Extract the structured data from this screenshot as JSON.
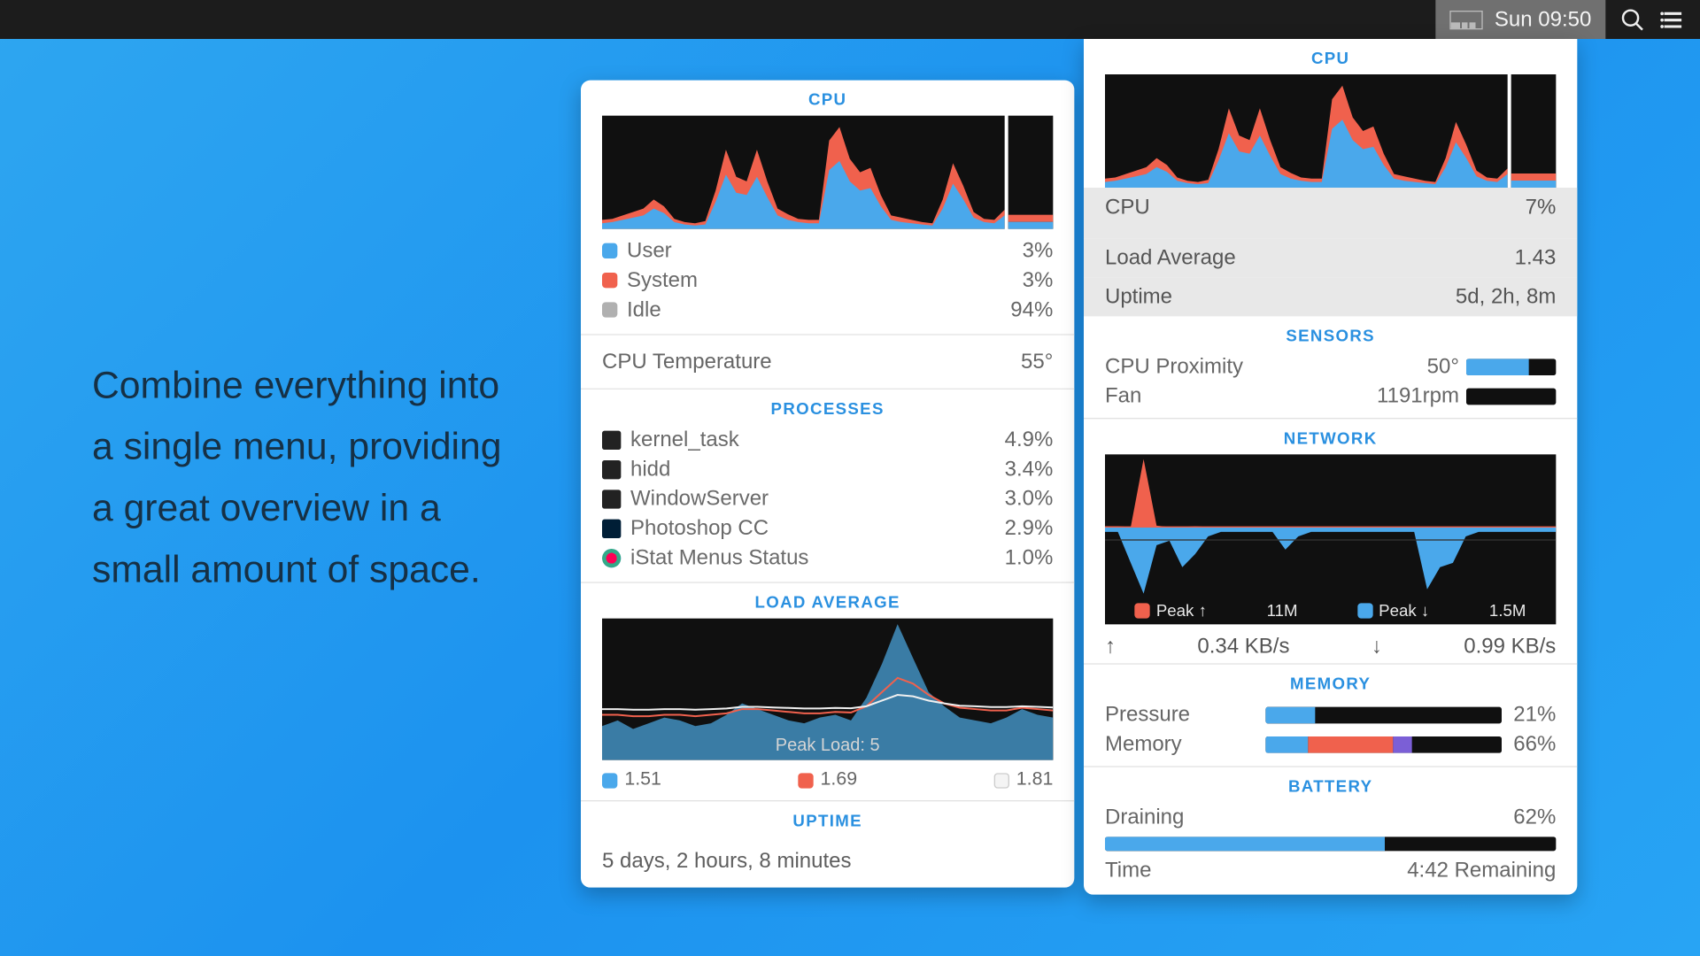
{
  "menubar": {
    "clock": "Sun 09:50"
  },
  "marketing": "Combine everything into a single menu, providing a great overview in a small amount of space.",
  "left_panel": {
    "cpu": {
      "title": "CPU",
      "legend": [
        {
          "label": "User",
          "value": "3%",
          "color": "blue"
        },
        {
          "label": "System",
          "value": "3%",
          "color": "red"
        },
        {
          "label": "Idle",
          "value": "94%",
          "color": "grey"
        }
      ],
      "temp_label": "CPU Temperature",
      "temp_value": "55°"
    },
    "processes": {
      "title": "PROCESSES",
      "items": [
        {
          "name": "kernel_task",
          "value": "4.9%",
          "icon": "term"
        },
        {
          "name": "hidd",
          "value": "3.4%",
          "icon": "term"
        },
        {
          "name": "WindowServer",
          "value": "3.0%",
          "icon": "term"
        },
        {
          "name": "Photoshop CC",
          "value": "2.9%",
          "icon": "ps"
        },
        {
          "name": "iStat Menus Status",
          "value": "1.0%",
          "icon": "istat"
        }
      ]
    },
    "load": {
      "title": "LOAD AVERAGE",
      "peak_label": "Peak Load: 5",
      "values": [
        "1.51",
        "1.69",
        "1.81"
      ]
    },
    "uptime": {
      "title": "UPTIME",
      "value": "5 days, 2 hours, 8 minutes"
    }
  },
  "right_panel": {
    "cpu": {
      "title": "CPU",
      "cpu_label": "CPU",
      "cpu_value": "7%",
      "load_label": "Load Average",
      "load_value": "1.43",
      "uptime_label": "Uptime",
      "uptime_value": "5d, 2h, 8m"
    },
    "sensors": {
      "title": "SENSORS",
      "rows": [
        {
          "label": "CPU Proximity",
          "value": "50°",
          "bar": 70
        },
        {
          "label": "Fan",
          "value": "1191rpm",
          "bar": 0
        }
      ]
    },
    "network": {
      "title": "NETWORK",
      "peak_up_label": "Peak ↑",
      "peak_up_value": "11M",
      "peak_down_label": "Peak ↓",
      "peak_down_value": "1.5M",
      "up_label": "↑",
      "up_value": "0.34 KB/s",
      "down_label": "↓",
      "down_value": "0.99 KB/s"
    },
    "memory": {
      "title": "MEMORY",
      "rows": [
        {
          "label": "Pressure",
          "value": "21%",
          "segments": [
            {
              "w": 21,
              "c": "#4aa8eb"
            }
          ]
        },
        {
          "label": "Memory",
          "value": "66%",
          "segments": [
            {
              "w": 18,
              "c": "#4aa8eb"
            },
            {
              "w": 36,
              "c": "#f0614d"
            },
            {
              "w": 8,
              "c": "#7b5fd6"
            }
          ]
        }
      ]
    },
    "battery": {
      "title": "BATTERY",
      "state_label": "Draining",
      "state_value": "62%",
      "time_label": "Time",
      "time_value": "4:42 Remaining",
      "bar": 62
    }
  },
  "chart_data": [
    {
      "name": "cpu_left_panel",
      "type": "area",
      "x": [
        0,
        1,
        2,
        3,
        4,
        5,
        6,
        7,
        8,
        9,
        10,
        11,
        12,
        13,
        14,
        15,
        16,
        17,
        18,
        19,
        20,
        21,
        22,
        23,
        24,
        25,
        26,
        27,
        28,
        29,
        30,
        31,
        32,
        33,
        34,
        35,
        36,
        37,
        38,
        39
      ],
      "series": [
        {
          "name": "User",
          "color": "#4aa8eb",
          "values": [
            5,
            6,
            8,
            10,
            12,
            18,
            14,
            6,
            4,
            3,
            4,
            24,
            48,
            32,
            30,
            46,
            28,
            12,
            8,
            6,
            5,
            5,
            52,
            60,
            42,
            34,
            36,
            20,
            8,
            6,
            5,
            4,
            3,
            18,
            40,
            26,
            10,
            6,
            5,
            12
          ]
        },
        {
          "name": "System",
          "color": "#f0614d",
          "values": [
            3,
            3,
            4,
            5,
            6,
            8,
            6,
            3,
            2,
            2,
            3,
            10,
            22,
            14,
            12,
            24,
            14,
            6,
            5,
            3,
            3,
            3,
            26,
            30,
            20,
            16,
            18,
            10,
            4,
            4,
            3,
            2,
            2,
            8,
            18,
            12,
            5,
            3,
            3,
            5
          ]
        }
      ],
      "ylim": [
        0,
        100
      ],
      "xlabel": "",
      "ylabel": "",
      "title": "CPU"
    },
    {
      "name": "load_average_left_panel",
      "type": "area",
      "x": [
        0,
        1,
        2,
        3,
        4,
        5,
        6,
        7,
        8,
        9,
        10,
        11,
        12,
        13,
        14,
        15,
        16,
        17,
        18,
        19,
        20,
        21,
        22,
        23,
        24,
        25,
        26,
        27,
        28,
        29
      ],
      "series": [
        {
          "name": "1m",
          "color": "#3a7ca5",
          "values": [
            1.2,
            1.4,
            1.1,
            1.3,
            1.5,
            1.4,
            1.2,
            1.3,
            1.6,
            2.0,
            1.8,
            1.6,
            1.4,
            1.3,
            1.5,
            1.6,
            1.4,
            2.2,
            3.4,
            4.8,
            3.6,
            2.4,
            1.9,
            1.5,
            1.4,
            1.3,
            1.5,
            1.8,
            1.6,
            1.5
          ]
        },
        {
          "name": "5m",
          "color": "#f0614d",
          "values": [
            1.6,
            1.6,
            1.55,
            1.55,
            1.6,
            1.6,
            1.55,
            1.6,
            1.65,
            1.8,
            1.8,
            1.75,
            1.7,
            1.65,
            1.65,
            1.7,
            1.68,
            1.9,
            2.4,
            2.9,
            2.7,
            2.3,
            2.0,
            1.85,
            1.8,
            1.75,
            1.75,
            1.85,
            1.8,
            1.75
          ]
        },
        {
          "name": "15m",
          "color": "#f0f0f0",
          "values": [
            1.8,
            1.8,
            1.78,
            1.78,
            1.8,
            1.8,
            1.78,
            1.8,
            1.82,
            1.88,
            1.88,
            1.86,
            1.84,
            1.82,
            1.82,
            1.84,
            1.83,
            1.9,
            2.1,
            2.3,
            2.25,
            2.1,
            2.0,
            1.92,
            1.9,
            1.87,
            1.87,
            1.9,
            1.88,
            1.86
          ]
        }
      ],
      "ylim": [
        0,
        5
      ],
      "peak": 5,
      "title": "LOAD AVERAGE"
    },
    {
      "name": "cpu_right_panel",
      "type": "area",
      "x": [
        0,
        1,
        2,
        3,
        4,
        5,
        6,
        7,
        8,
        9,
        10,
        11,
        12,
        13,
        14,
        15,
        16,
        17,
        18,
        19,
        20,
        21,
        22,
        23,
        24,
        25,
        26,
        27,
        28,
        29,
        30,
        31,
        32,
        33,
        34,
        35,
        36,
        37,
        38,
        39
      ],
      "series": [
        {
          "name": "User",
          "color": "#4aa8eb",
          "values": [
            5,
            6,
            8,
            10,
            12,
            18,
            14,
            6,
            4,
            3,
            4,
            24,
            48,
            32,
            30,
            46,
            28,
            12,
            8,
            6,
            5,
            5,
            52,
            60,
            42,
            34,
            36,
            20,
            8,
            6,
            5,
            4,
            3,
            18,
            40,
            26,
            10,
            6,
            5,
            12
          ]
        },
        {
          "name": "System",
          "color": "#f0614d",
          "values": [
            3,
            3,
            4,
            5,
            6,
            8,
            6,
            3,
            2,
            2,
            3,
            10,
            22,
            14,
            12,
            24,
            14,
            6,
            5,
            3,
            3,
            3,
            26,
            30,
            20,
            16,
            18,
            10,
            4,
            4,
            3,
            2,
            2,
            8,
            18,
            12,
            5,
            3,
            3,
            5
          ]
        }
      ],
      "ylim": [
        0,
        100
      ],
      "title": "CPU"
    },
    {
      "name": "network_right_panel",
      "type": "area",
      "x": [
        0,
        1,
        2,
        3,
        4,
        5,
        6,
        7,
        8,
        9,
        10,
        11,
        12,
        13,
        14,
        15,
        16,
        17,
        18,
        19,
        20,
        21,
        22,
        23,
        24,
        25,
        26,
        27,
        28,
        29,
        30,
        31,
        32,
        33,
        34,
        35
      ],
      "series": [
        {
          "name": "Upload",
          "color": "#f0614d",
          "values": [
            0.2,
            0.2,
            0.1,
            11,
            0.3,
            0.1,
            0.1,
            0.2,
            0.1,
            0.1,
            0.1,
            0.1,
            0.1,
            0.1,
            0.1,
            0.1,
            0.1,
            0.1,
            0.1,
            0.1,
            0.1,
            0.1,
            0.1,
            0.1,
            0.1,
            0.1,
            0.1,
            0.1,
            0.1,
            0.1,
            0.1,
            0.1,
            0.1,
            0.1,
            0.1,
            0.1
          ]
        },
        {
          "name": "Download",
          "color": "#4aa8eb",
          "values": [
            0.1,
            0.1,
            0.8,
            1.5,
            0.4,
            0.3,
            0.9,
            0.6,
            0.2,
            0.1,
            0.1,
            0.1,
            0.1,
            0.1,
            0.5,
            0.2,
            0.1,
            0.1,
            0.1,
            0.1,
            0.1,
            0.1,
            0.1,
            0.1,
            0.1,
            1.4,
            0.9,
            0.8,
            0.2,
            0.1,
            0.1,
            0.1,
            0.1,
            0.1,
            0.1,
            0.1
          ]
        }
      ],
      "ylim_up": [
        0,
        11
      ],
      "ylim_down": [
        0,
        1.5
      ],
      "title": "NETWORK"
    }
  ]
}
